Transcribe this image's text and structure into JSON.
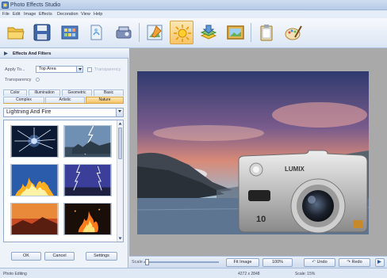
{
  "window": {
    "title": "Photo Effects Studio"
  },
  "menu": [
    "File",
    "Edit",
    "Image",
    "Effects",
    "Decoration",
    "View",
    "Help"
  ],
  "toolbar": {
    "tools": [
      "open-folder-icon",
      "save-icon",
      "filmstrip-icon",
      "scanner-icon",
      "camera-import-icon",
      "adjust-icon",
      "effects-sun-icon",
      "layers-icon",
      "frame-icon",
      "clipboard-icon",
      "brush-palette-icon"
    ],
    "active_tool": "effects-sun-icon"
  },
  "panel": {
    "title": "Effects And Filters",
    "apply_to_label": "Apply To...",
    "apply_to_value": "Top Area",
    "transparency_checkbox_label": "Transparency",
    "transparency_label": "Transparency",
    "tabs_row1": [
      "Color",
      "Illumination",
      "Geometric",
      "Basic"
    ],
    "tabs_row2": [
      "Complex",
      "Artistic",
      "Nature"
    ],
    "active_tab": "Nature",
    "effect_selected": "Lightning And Fire",
    "buttons": {
      "ok": "OK",
      "cancel": "Cancel",
      "settings": "Settings"
    }
  },
  "viewbar": {
    "scale_label": "Scale",
    "fit_image": "Fit Image",
    "hundred": "100%",
    "undo": "Undo",
    "redo": "Redo"
  },
  "status": {
    "left": "Photo Editing",
    "dimensions": "4272 x 2848",
    "scale": "Scale: 15%"
  },
  "colors": {
    "accent": "#f6c467",
    "panel_bg": "#eef3fa",
    "canvas_bg": "#a9a9a9"
  }
}
